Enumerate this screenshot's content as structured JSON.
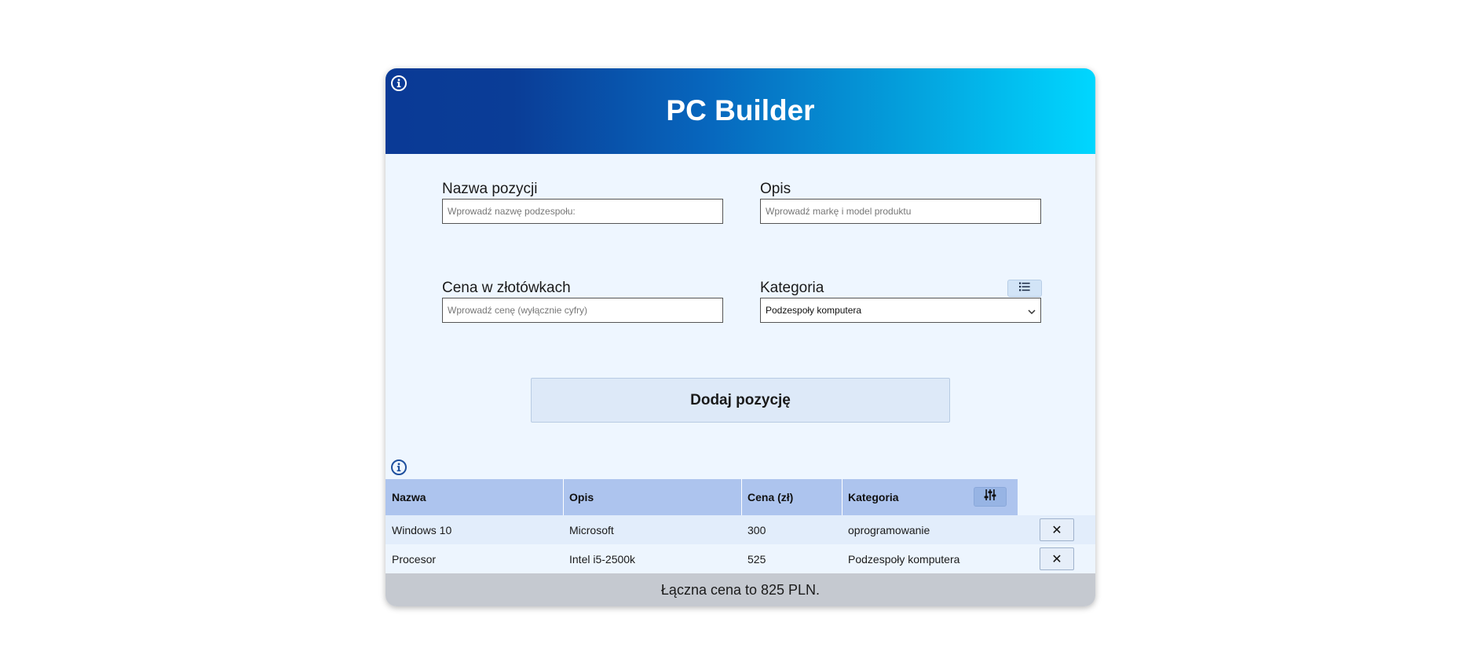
{
  "app": {
    "title": "PC Builder"
  },
  "form": {
    "name": {
      "label": "Nazwa pozycji",
      "placeholder": "Wprowadź nazwę podzespołu:",
      "value": ""
    },
    "description": {
      "label": "Opis",
      "placeholder": "Wprowadź markę i model produktu",
      "value": ""
    },
    "price": {
      "label": "Cena w złotówkach",
      "placeholder": "Wprowadź cenę (wyłącznie cyfry)",
      "value": ""
    },
    "category": {
      "label": "Kategoria",
      "selected": "Podzespoły komputera"
    },
    "add_label": "Dodaj pozycję"
  },
  "table": {
    "headers": {
      "name": "Nazwa",
      "description": "Opis",
      "price": "Cena (zł)",
      "category": "Kategoria"
    },
    "rows": [
      {
        "name": "Windows 10",
        "description": "Microsoft",
        "price": "300",
        "category": "oprogramowanie"
      },
      {
        "name": "Procesor",
        "description": "Intel i5-2500k",
        "price": "525",
        "category": "Podzespoły komputera"
      }
    ],
    "delete_symbol": "✕"
  },
  "footer": {
    "total_text": "Łączna cena to 825 PLN."
  },
  "icons": {
    "header_info": "info-circle-icon",
    "table_info": "info-circle-icon",
    "category_list": "list-icon",
    "filter": "sliders-icon",
    "select_chevron": "chevron-down-icon"
  },
  "colors": {
    "header_gradient_start": "#0a3a96",
    "header_gradient_end": "#00d7ff",
    "card_background": "#eef6ff",
    "table_header": "#adc4ee",
    "footer_background": "#c5c9d0"
  }
}
